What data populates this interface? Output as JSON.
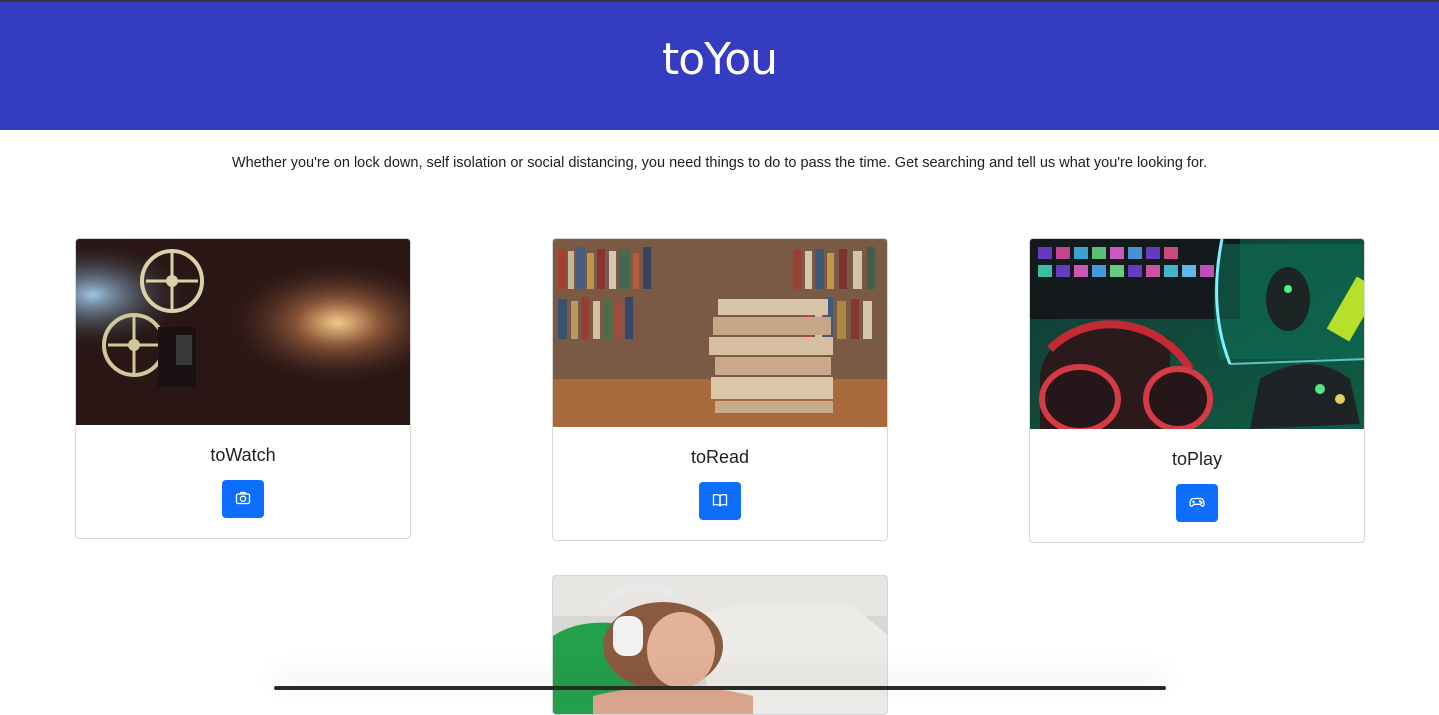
{
  "header": {
    "brand": "toYou"
  },
  "intro": {
    "text": "Whether you're on lock down, self isolation or social distancing, you need things to do to pass the time. Get searching and tell us what you're looking for."
  },
  "cards": [
    {
      "title": "toWatch",
      "icon": "camera-icon",
      "image": "film-projector-photo"
    },
    {
      "title": "toRead",
      "icon": "book-icon",
      "image": "stack-of-books-photo"
    },
    {
      "title": "toPlay",
      "icon": "gamepad-icon",
      "image": "gaming-setup-photo"
    },
    {
      "title": "",
      "icon": "",
      "image": "woman-with-headphones-photo"
    }
  ],
  "colors": {
    "header_bg": "#343cc2",
    "button_bg": "#0d6efd"
  }
}
